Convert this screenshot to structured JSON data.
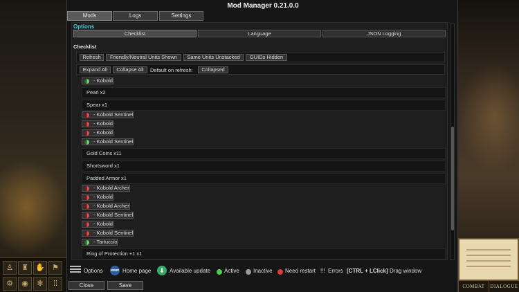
{
  "window": {
    "title": "Mod Manager 0.21.0.0"
  },
  "main_tabs": [
    "Mods",
    "Logs",
    "Settings"
  ],
  "options": {
    "label": "Options",
    "tabs": [
      "Checklist",
      "Language",
      "JSON Logging"
    ]
  },
  "checklist": {
    "title": "Checklist",
    "toolbar1": [
      "Refresh",
      "Friendly/Neutral Units Shown",
      "Same Units Unstacked",
      "GUIDs Hidden"
    ],
    "toolbar2": {
      "expand": "Expand All",
      "collapse": "Collapse All",
      "default_label": "Default on refresh:",
      "default_value": "Collapsed"
    },
    "entries": [
      {
        "kind": "unit",
        "status": "green",
        "label": "- Kobold"
      },
      {
        "kind": "item",
        "label": "Pearl x2"
      },
      {
        "kind": "item",
        "label": "Spear x1"
      },
      {
        "kind": "unit",
        "status": "red",
        "label": "- Kobold Sentinel"
      },
      {
        "kind": "unit",
        "status": "red",
        "label": "- Kobold"
      },
      {
        "kind": "unit",
        "status": "red",
        "label": "- Kobold"
      },
      {
        "kind": "unit",
        "status": "green",
        "label": "- Kobold Sentinel"
      },
      {
        "kind": "item",
        "label": "Gold Coins x11"
      },
      {
        "kind": "item",
        "label": "Shortsword x1"
      },
      {
        "kind": "item",
        "label": "Padded Armor x1"
      },
      {
        "kind": "unit",
        "status": "red",
        "label": "- Kobold Archer"
      },
      {
        "kind": "unit",
        "status": "red",
        "label": "- Kobold"
      },
      {
        "kind": "unit",
        "status": "red",
        "label": "- Kobold Archer"
      },
      {
        "kind": "unit",
        "status": "red",
        "label": "- Kobold Sentinel"
      },
      {
        "kind": "unit",
        "status": "red",
        "label": "- Kobold"
      },
      {
        "kind": "unit",
        "status": "red",
        "label": "- Kobold Sentinel"
      },
      {
        "kind": "unit",
        "status": "green",
        "label": "- Tartuccio"
      },
      {
        "kind": "item",
        "label": "Ring of Protection +1 x1"
      }
    ]
  },
  "footer": {
    "options": "Options",
    "home_page": "Home page",
    "home_icon_text": "www",
    "available_update": "Available update",
    "active": "Active",
    "inactive": "Inactive",
    "need_restart": "Need restart",
    "errors_mark": "!!!",
    "errors": "Errors",
    "shortcut": "[CTRL + LClick]",
    "drag": "Drag window",
    "close": "Close",
    "save": "Save"
  },
  "game_hud": {
    "tabs": [
      "COMBAT",
      "DIALOGUE"
    ]
  },
  "colors": {
    "accent": "#4cc6e0",
    "active": "#4ccf4c",
    "inactive": "#9a9a9a",
    "restart": "#e03a3a",
    "update": "#3aa868"
  }
}
